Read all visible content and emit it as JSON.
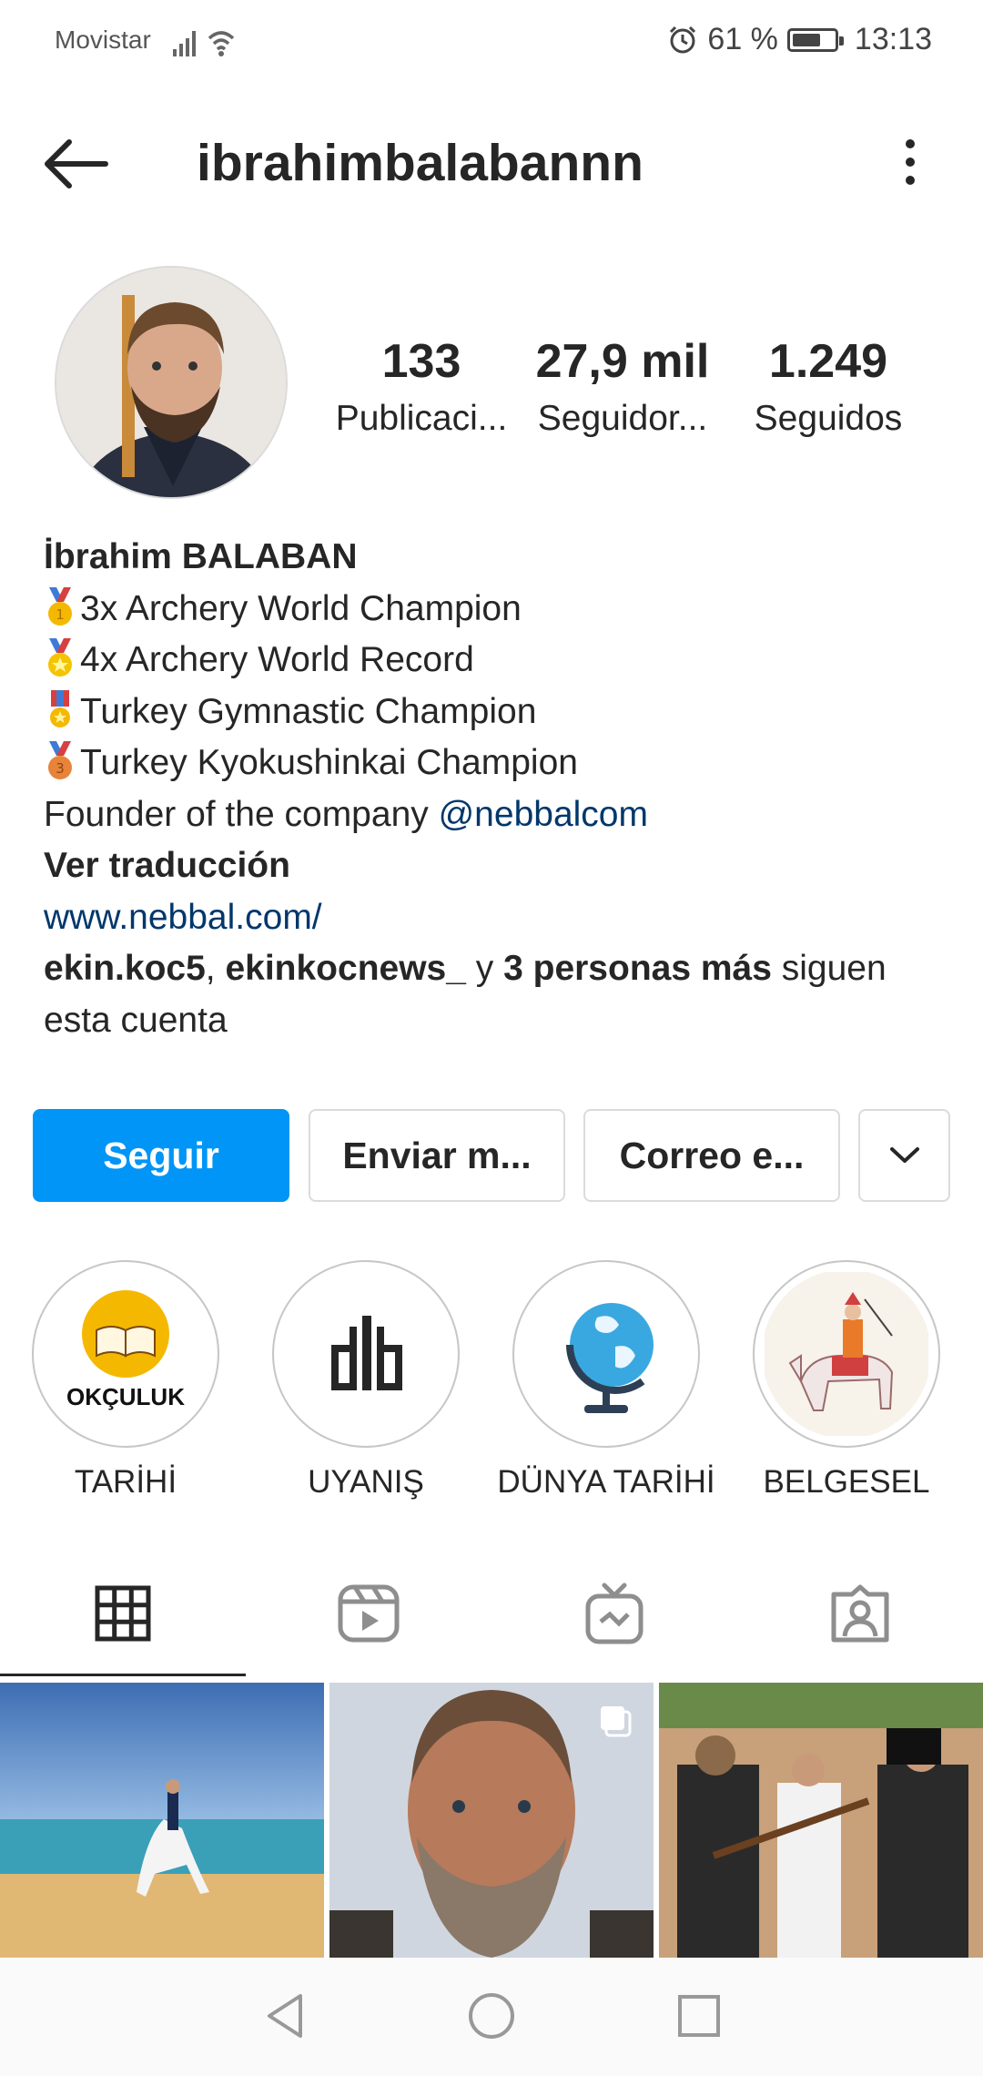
{
  "status_bar": {
    "carrier": "Movistar",
    "battery": "61 %",
    "battery_level": 0.61,
    "time": "13:13"
  },
  "header": {
    "username": "ibrahimbalabannn"
  },
  "stats": [
    {
      "value": "133",
      "label": "Publicaci..."
    },
    {
      "value": "27,9 mil",
      "label": "Seguidor..."
    },
    {
      "value": "1.249",
      "label": "Seguidos"
    }
  ],
  "bio": {
    "name": "İbrahim BALABAN",
    "lines": [
      {
        "icon": "gold-medal-icon",
        "text": "3x Archery World Champion"
      },
      {
        "icon": "sports-medal-icon",
        "text": "4x Archery World Record"
      },
      {
        "icon": "military-medal-icon",
        "text": "Turkey Gymnastic Champion"
      },
      {
        "icon": "bronze-medal-icon",
        "text": "Turkey Kyokushinkai Champion"
      }
    ],
    "founder_prefix": "Founder of the company ",
    "founder_mention": "@nebbalcom",
    "translate": "Ver traducción",
    "website": "www.nebbal.com/",
    "followed_by": {
      "user1": "ekin.koc5",
      "sep": ", ",
      "user2": "ekinkocnews_",
      "and": " y ",
      "others": "3 personas más",
      "suffix": " siguen",
      "line2": "esta cuenta"
    }
  },
  "actions": {
    "follow": "Seguir",
    "message": "Enviar m...",
    "email": "Correo e...",
    "more_icon": "chevron-down-icon"
  },
  "highlights": [
    {
      "label": "TARİHİ",
      "cover_text": "OKÇULUK"
    },
    {
      "label": "UYANIŞ"
    },
    {
      "label": "DÜNYA TARİHİ"
    },
    {
      "label": "BELGESEL"
    }
  ],
  "tabs": [
    {
      "icon": "grid-icon",
      "active": true
    },
    {
      "icon": "reels-icon",
      "active": false
    },
    {
      "icon": "igtv-icon",
      "active": false
    },
    {
      "icon": "tagged-icon",
      "active": false
    }
  ],
  "posts": [
    {
      "icon": "horse-beach-photo"
    },
    {
      "icon": "bearded-man-photo",
      "multi": true
    },
    {
      "icon": "film-crew-photo"
    }
  ],
  "colors": {
    "accent": "#0095f6",
    "link": "#00376b",
    "text": "#262626",
    "border": "#dbdbdb"
  }
}
